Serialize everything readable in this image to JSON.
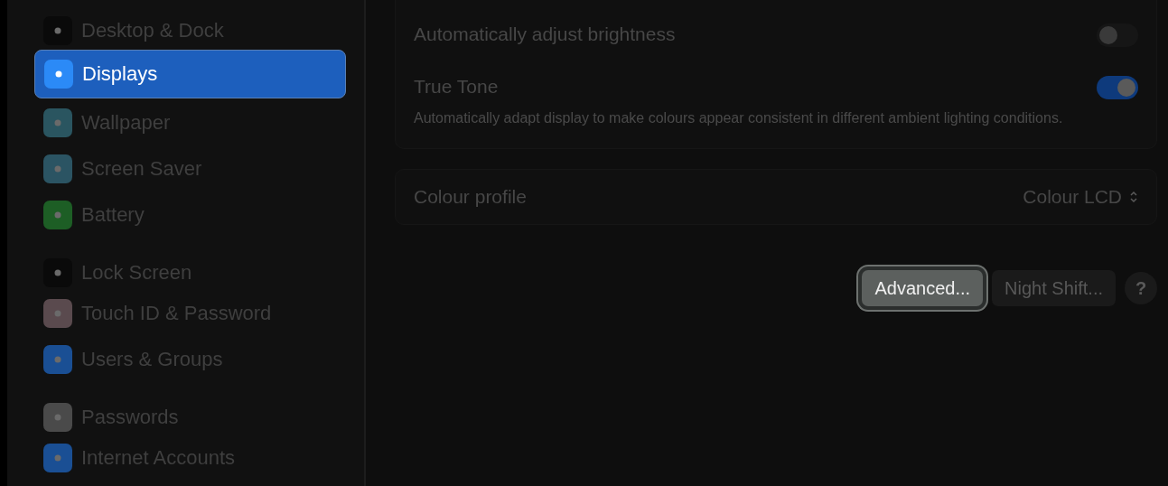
{
  "sidebar": {
    "groups": [
      {
        "items": [
          {
            "label": "Desktop & Dock",
            "selected": false,
            "color": "#0a0a0a"
          },
          {
            "label": "Displays",
            "selected": true,
            "color": "#2b8af7"
          },
          {
            "label": "Wallpaper",
            "selected": false,
            "color": "#2a5560"
          },
          {
            "label": "Screen Saver",
            "selected": false,
            "color": "#2b5463"
          },
          {
            "label": "Battery",
            "selected": false,
            "color": "#1d5e25"
          }
        ]
      },
      {
        "items": [
          {
            "label": "Lock Screen",
            "selected": false,
            "color": "#0a0a0a"
          },
          {
            "label": "Touch ID & Password",
            "selected": false,
            "color": "#5a4a4e"
          },
          {
            "label": "Users & Groups",
            "selected": false,
            "color": "#1a4f94"
          }
        ]
      },
      {
        "items": [
          {
            "label": "Passwords",
            "selected": false,
            "color": "#4a4a4a"
          },
          {
            "label": "Internet Accounts",
            "selected": false,
            "color": "#1a4f94"
          }
        ]
      }
    ]
  },
  "settings": [
    {
      "label": "Automatically adjust brightness",
      "on": false
    },
    {
      "label": "True Tone",
      "on": true,
      "description": "Automatically adapt display to make colours appear consistent in different ambient lighting conditions."
    }
  ],
  "colour_profile": {
    "label": "Colour profile",
    "value": "Colour LCD"
  },
  "buttons": [
    {
      "label": "Advanced...",
      "focused": true
    },
    {
      "label": "Night Shift...",
      "focused": false
    }
  ],
  "help": {
    "label": "?"
  }
}
